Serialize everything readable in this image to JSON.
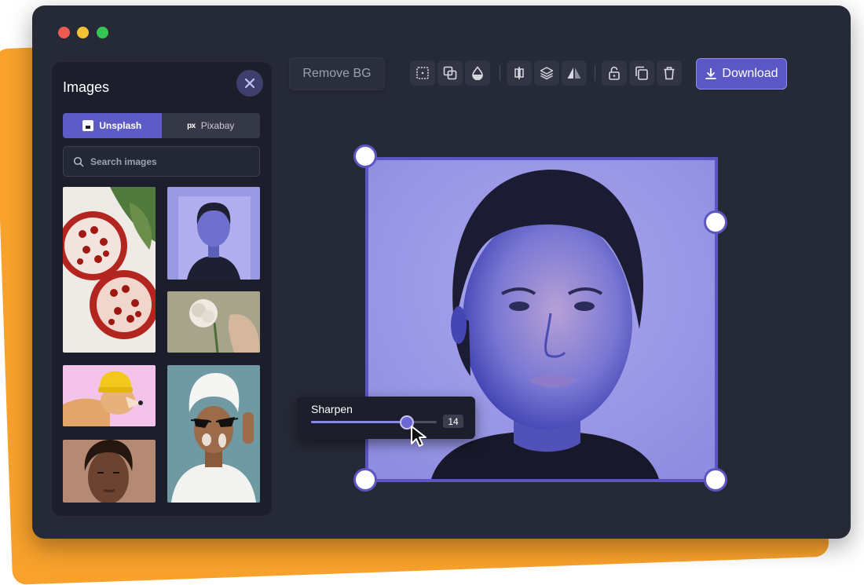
{
  "window": {
    "controls": [
      "close",
      "minimize",
      "maximize"
    ]
  },
  "panel": {
    "title": "Images",
    "close_icon": "close-icon",
    "tabs": [
      {
        "label": "Unsplash",
        "icon": "unsplash-logo-icon",
        "active": true
      },
      {
        "label": "Pixabay",
        "icon": "pixabay-logo-icon",
        "active": false
      }
    ],
    "search": {
      "placeholder": "Search images",
      "value": ""
    },
    "images": [
      {
        "subject": "pomegranates"
      },
      {
        "subject": "woman-portrait-blue"
      },
      {
        "subject": "rose-in-hand"
      },
      {
        "subject": "dog-in-yellow-hat"
      },
      {
        "subject": "woman-with-towel-and-sunglasses"
      },
      {
        "subject": "woman-portrait"
      }
    ]
  },
  "toolbar": {
    "remove_bg_label": "Remove BG",
    "icons": [
      "grid-icon",
      "overlap-icon",
      "opacity-drop-icon",
      "align-center-icon",
      "layers-icon",
      "flip-icon",
      "unlock-icon",
      "duplicate-icon",
      "delete-icon"
    ],
    "download_label": "Download"
  },
  "canvas": {
    "image_subject": "woman-portrait-blue-light"
  },
  "sharpen": {
    "label": "Sharpen",
    "value": "14",
    "fraction": 0.76
  },
  "colors": {
    "accent": "#5b58c5",
    "window_bg": "#262a37",
    "panel_bg": "#1c1f2b",
    "backdrop": "#f8a12c"
  }
}
